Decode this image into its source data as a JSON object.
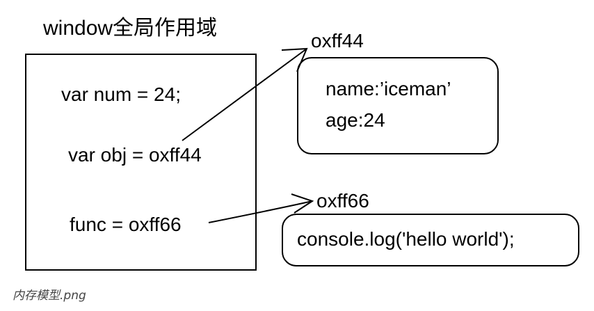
{
  "window_box": {
    "title": "window全局作用域",
    "lines": [
      "var num = 24;",
      "var obj = oxff44",
      "func = oxff66"
    ]
  },
  "heap_object": {
    "address": "oxff44",
    "lines": [
      "name:’iceman’",
      "age:24"
    ]
  },
  "heap_function": {
    "address": "oxff66",
    "body": "console.log('hello world');"
  },
  "caption": "内存模型.png"
}
